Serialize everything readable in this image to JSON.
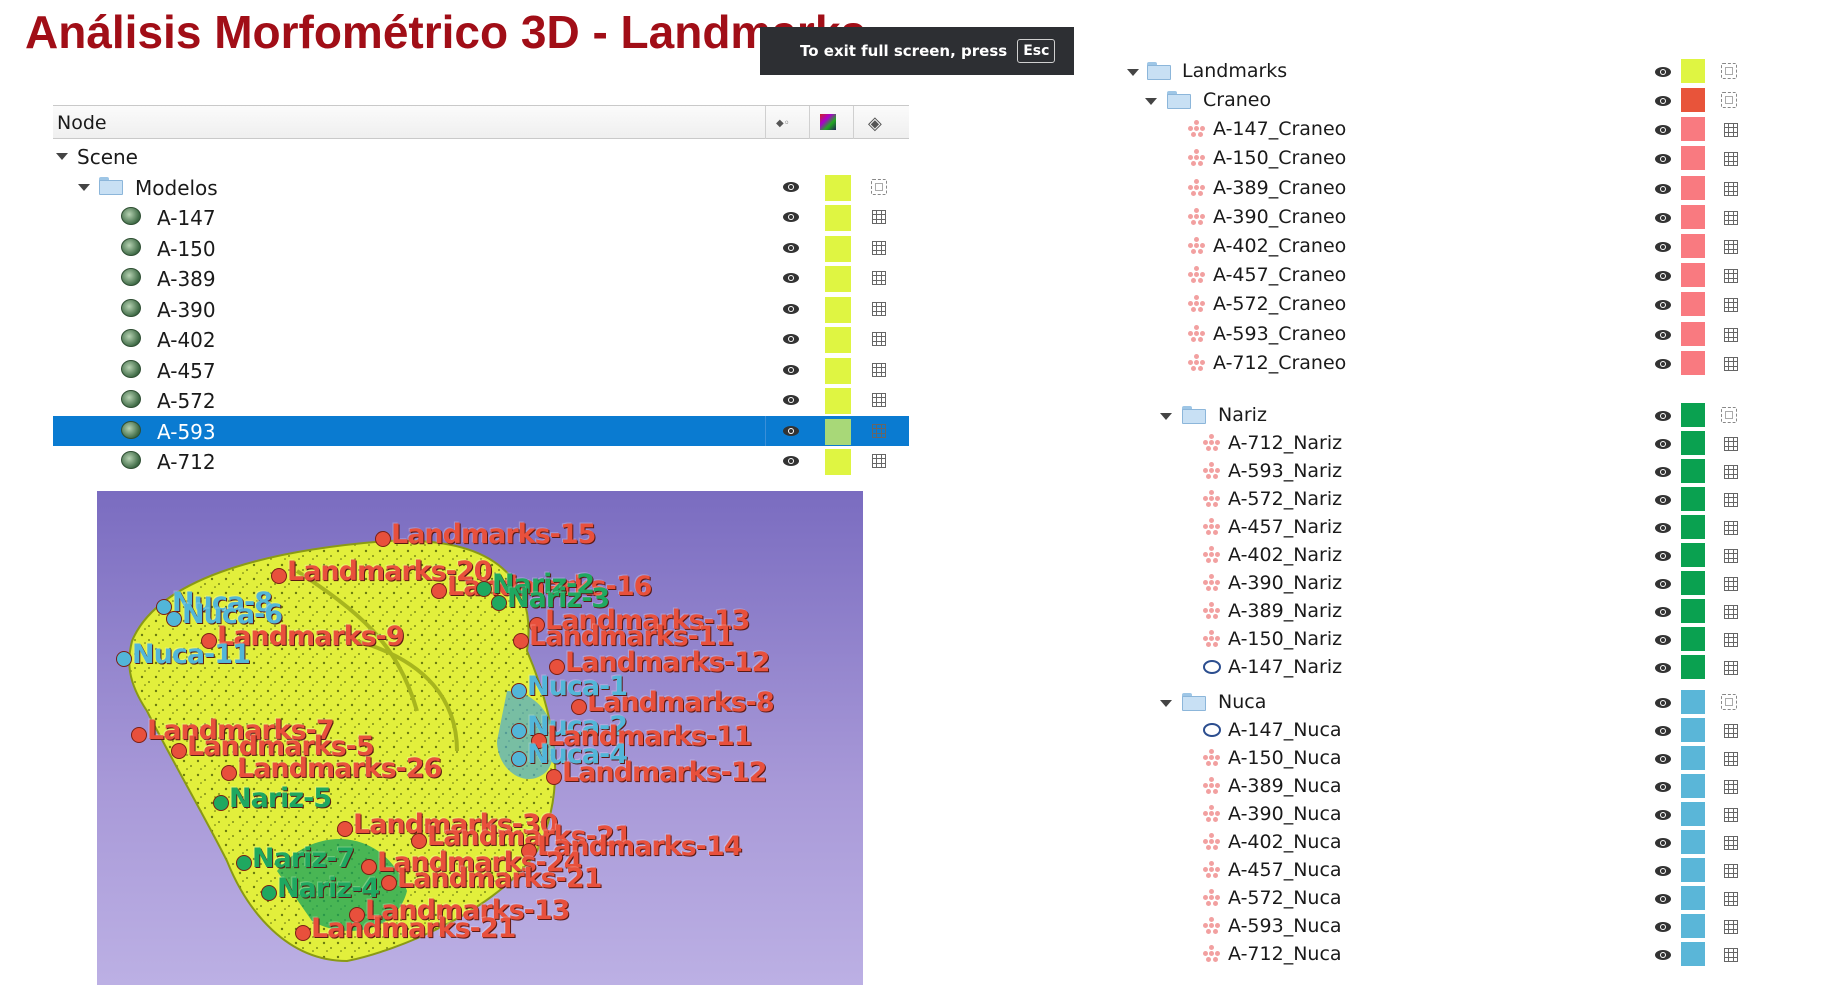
{
  "slide": {
    "title": "Análisis Morfométrico 3D - Landmarks"
  },
  "fullscreen_toast": {
    "text": "To exit full screen, press",
    "key": "Esc"
  },
  "left_tree": {
    "header": {
      "node": "Node"
    },
    "scene": "Scene",
    "folder": "Modelos",
    "folder_color": "#dff542",
    "models": [
      {
        "label": "A-147",
        "color": "#dff542"
      },
      {
        "label": "A-150",
        "color": "#dff542"
      },
      {
        "label": "A-389",
        "color": "#dff542"
      },
      {
        "label": "A-390",
        "color": "#dff542"
      },
      {
        "label": "A-402",
        "color": "#dff542"
      },
      {
        "label": "A-457",
        "color": "#dff542"
      },
      {
        "label": "A-572",
        "color": "#dff542"
      },
      {
        "label": "A-593",
        "color": "#a8d878",
        "selected": true
      },
      {
        "label": "A-712",
        "color": "#dff542"
      }
    ],
    "selection_color": "#0a7bd1"
  },
  "viewer": {
    "background_top": "#7a6cc0",
    "background_bottom": "#bcb0e4",
    "model_color": "#e2ef3c",
    "labels": [
      {
        "text": "Landmarks-15",
        "color": "#e8503c"
      },
      {
        "text": "Landmarks-20",
        "color": "#e8503c"
      },
      {
        "text": "Landmarks-16",
        "color": "#e8503c"
      },
      {
        "text": "Nariz-2",
        "color": "#1fa860"
      },
      {
        "text": "Nariz-3",
        "color": "#1fa860"
      },
      {
        "text": "Nuca-8",
        "color": "#52b6d8"
      },
      {
        "text": "Nuca-6",
        "color": "#52b6d8"
      },
      {
        "text": "Landmarks-13",
        "color": "#e8503c"
      },
      {
        "text": "Landmarks-11",
        "color": "#e8503c"
      },
      {
        "text": "Landmarks-9",
        "color": "#e8503c"
      },
      {
        "text": "Landmarks-12",
        "color": "#e8503c"
      },
      {
        "text": "Nuca-11",
        "color": "#52b6d8"
      },
      {
        "text": "Landmarks-8",
        "color": "#e8503c"
      },
      {
        "text": "Nuca-1",
        "color": "#52b6d8"
      },
      {
        "text": "Nuca-2",
        "color": "#52b6d8"
      },
      {
        "text": "Landmarks-7",
        "color": "#e8503c"
      },
      {
        "text": "Landmarks-11",
        "color": "#e8503c"
      },
      {
        "text": "Landmarks-5",
        "color": "#e8503c"
      },
      {
        "text": "Nuca-4",
        "color": "#52b6d8"
      },
      {
        "text": "Landmarks-26",
        "color": "#e8503c"
      },
      {
        "text": "Landmarks-12",
        "color": "#e8503c"
      },
      {
        "text": "Nariz-5",
        "color": "#1fa860"
      },
      {
        "text": "Landmarks-30",
        "color": "#e8503c"
      },
      {
        "text": "Landmarks-21",
        "color": "#e8503c"
      },
      {
        "text": "Landmarks-14",
        "color": "#e8503c"
      },
      {
        "text": "Nariz-7",
        "color": "#1fa860"
      },
      {
        "text": "Landmarks-24",
        "color": "#e8503c"
      },
      {
        "text": "Landmarks-21",
        "color": "#e8503c"
      },
      {
        "text": "Nariz-4",
        "color": "#1fa860"
      },
      {
        "text": "Landmarks-13",
        "color": "#e8503c"
      },
      {
        "text": "Landmarks-21",
        "color": "#e8503c"
      }
    ]
  },
  "right_tree": {
    "root": {
      "label": "Landmarks",
      "color": "#dff542"
    },
    "groups": [
      {
        "label": "Craneo",
        "color": "#e8543a",
        "item_color": "#f97a80",
        "items": [
          "A-147_Craneo",
          "A-150_Craneo",
          "A-389_Craneo",
          "A-390_Craneo",
          "A-402_Craneo",
          "A-457_Craneo",
          "A-572_Craneo",
          "A-593_Craneo",
          "A-712_Craneo"
        ]
      },
      {
        "label": "Nariz",
        "color": "#0aa150",
        "item_color": "#0aa150",
        "items": [
          "A-712_Nariz",
          "A-593_Nariz",
          "A-572_Nariz",
          "A-457_Nariz",
          "A-402_Nariz",
          "A-390_Nariz",
          "A-389_Nariz",
          "A-150_Nariz",
          "A-147_Nariz"
        ],
        "curve_items": [
          "A-147_Nariz"
        ]
      },
      {
        "label": "Nuca",
        "color": "#5ab6d8",
        "item_color": "#5ab6d8",
        "items": [
          "A-147_Nuca",
          "A-150_Nuca",
          "A-389_Nuca",
          "A-390_Nuca",
          "A-402_Nuca",
          "A-457_Nuca",
          "A-572_Nuca",
          "A-593_Nuca",
          "A-712_Nuca"
        ],
        "curve_items": [
          "A-147_Nuca"
        ]
      }
    ]
  }
}
